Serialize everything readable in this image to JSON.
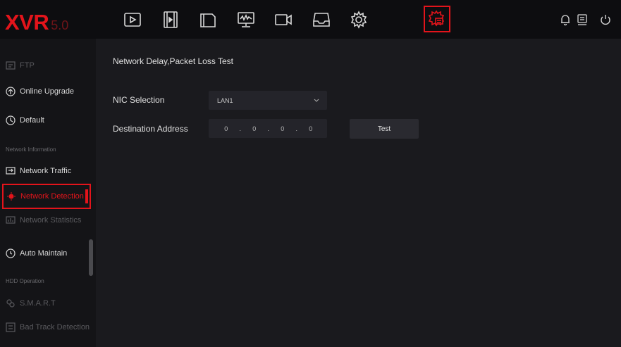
{
  "app": {
    "logo_main": "XVR",
    "logo_version": "5.0"
  },
  "topnav": {
    "items": [
      {
        "icon": "play-icon"
      },
      {
        "icon": "playback-film-icon"
      },
      {
        "icon": "folder-icon"
      },
      {
        "icon": "monitor-signal-icon"
      },
      {
        "icon": "camera-icon"
      },
      {
        "icon": "storage-tray-icon"
      },
      {
        "icon": "gear-icon"
      },
      {
        "icon": "system-settings-icon",
        "active": true
      }
    ],
    "right_icons": [
      "bell-icon",
      "display-icon",
      "power-icon"
    ]
  },
  "sidebar": {
    "items": [
      {
        "label": "FTP",
        "icon": "ftp-icon",
        "dim": true
      },
      {
        "label": "Online Upgrade",
        "icon": "upgrade-icon"
      },
      {
        "label": "Default",
        "icon": "default-icon"
      },
      {
        "label": "Network Traffic",
        "icon": "network-traffic-icon"
      },
      {
        "label": "Network Detection",
        "icon": "network-detection-icon",
        "active": true
      },
      {
        "label": "Network Statistics",
        "icon": "network-statistics-icon",
        "dim": true
      },
      {
        "label": "Auto Maintain",
        "icon": "auto-maintain-icon"
      },
      {
        "label": "S.M.A.R.T",
        "icon": "smart-icon",
        "dim": true
      },
      {
        "label": "Bad Track Detection",
        "icon": "bad-track-icon",
        "dim": true
      }
    ],
    "headers": {
      "network_information": "Network Information",
      "hdd_operation": "HDD Operation"
    }
  },
  "main": {
    "title": "Network Delay,Packet Loss Test",
    "nic_label": "NIC Selection",
    "nic_value": "LAN1",
    "dest_label": "Destination Address",
    "ip": [
      "0",
      "0",
      "0",
      "0"
    ],
    "test_button": "Test"
  },
  "colors": {
    "accent": "#e3141b",
    "background": "#1a1a1e",
    "topbar": "#0d0d10"
  }
}
